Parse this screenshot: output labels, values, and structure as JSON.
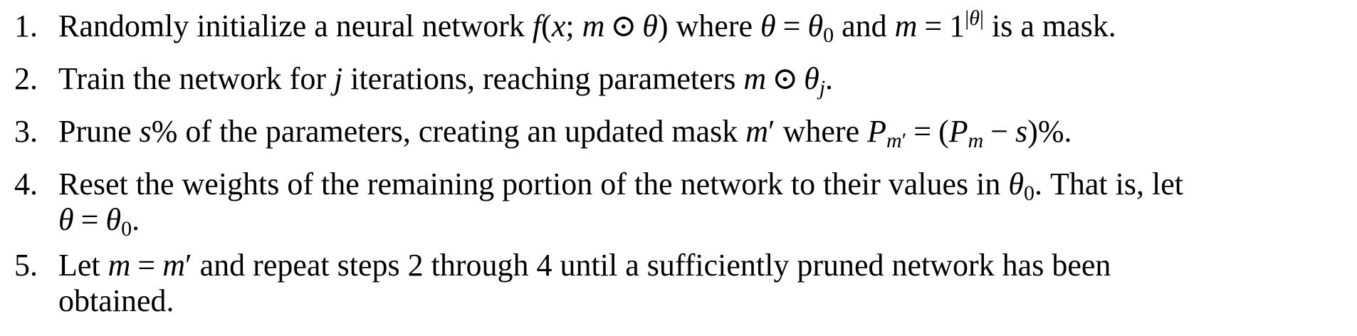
{
  "steps": [
    {
      "num": "1.",
      "pre": "Randomly initialize a neural network ",
      "mid1": " where ",
      "mid2": " and ",
      "post": " is a mask."
    },
    {
      "num": "2.",
      "pre": "Train the network for ",
      "mid": " iterations, reaching parameters ",
      "post": "."
    },
    {
      "num": "3.",
      "pre": "Prune ",
      "mid": "% of the parameters, creating an updated mask ",
      "mid2": " where ",
      "post": "%."
    },
    {
      "num": "4.",
      "line1_pre": "Reset the weights of the remaining portion of the network to their values in ",
      "line1_post": ". That is, let",
      "line2_post": "."
    },
    {
      "num": "5.",
      "pre": "Let ",
      "mid": " and repeat steps 2 through 4 until a sufficiently pruned network has been",
      "line2": "obtained."
    }
  ]
}
